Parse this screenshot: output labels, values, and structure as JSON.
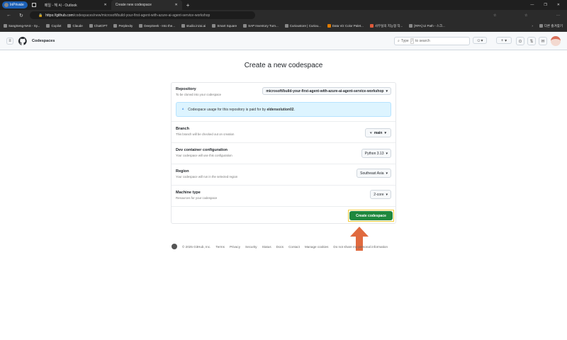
{
  "browser": {
    "inprivate": "InPrivate",
    "tabs": [
      {
        "title": "메일 - 헤 씨 - Outlook"
      },
      {
        "title": "Create new codespace"
      }
    ],
    "url_host": "https://github.com",
    "url_path": "/codespaces/new/microsoft/build-your-first-agent-with-azure-ai-agent-service-workshop",
    "bookmarks": [
      "SangSeng-NAS - Sy...",
      "Copilot",
      "Claude",
      "ChatGPT",
      "Perplexity",
      "DeepSeek - Into the...",
      "studio.inzai.ai",
      "Smart Square",
      "SAP Inventory Turn...",
      "Curioustore | Curiou...",
      "Data Viz Color Palet...",
      "사무실의 지능형 작...",
      "[RPA] Ui Path - 스크..."
    ],
    "other_favorites": "다른 즐겨찾기"
  },
  "header": {
    "title": "Codespaces",
    "search_prefix": "Type",
    "search_key": "/",
    "search_suffix": "to search"
  },
  "page": {
    "title": "Create a new codespace",
    "repository": {
      "label": "Repository",
      "sub": "To be cloned into your codespace",
      "value": "microsoft/build-your-first-agent-with-azure-ai-agent-service-workshop"
    },
    "info": {
      "text": "Codespace usage for this repository is paid for by",
      "owner": "eldensolution02",
      "period": "."
    },
    "branch": {
      "label": "Branch",
      "sub": "This branch will be checked out on creation",
      "value": "main"
    },
    "devcontainer": {
      "label": "Dev container configuration",
      "sub": "Your codespace will use this configuration",
      "value": "Python 3.13"
    },
    "region": {
      "label": "Region",
      "sub": "Your codespace will run in the selected region",
      "value": "Southeast Asia"
    },
    "machine": {
      "label": "Machine type",
      "sub": "Resources for your codespace",
      "value": "2-core"
    },
    "create_button": "Create codespace"
  },
  "footer": {
    "copyright": "© 2025 GitHub, Inc.",
    "links": [
      "Terms",
      "Privacy",
      "Security",
      "Status",
      "Docs",
      "Contact",
      "Manage cookies",
      "Do not share my personal information"
    ]
  },
  "colors": {
    "accent": "#1f883d",
    "highlight": "#f5cc3a",
    "arrow": "#e06a3f"
  }
}
